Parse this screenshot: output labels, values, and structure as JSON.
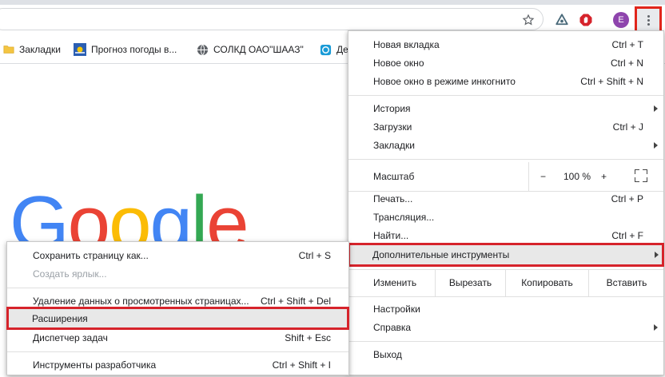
{
  "bookmarks": [
    {
      "label": "Закладки",
      "icon": "folder-icon"
    },
    {
      "label": "Прогноз погоды в...",
      "icon": "weather-icon"
    },
    {
      "label": "СОЛКД ОАО\"ШААЗ\"",
      "icon": "globe-icon"
    },
    {
      "label": "Де",
      "icon": "app-icon"
    }
  ],
  "toolbar": {
    "avatar_initial": "E"
  },
  "logo": {
    "letters": [
      "G",
      "o",
      "o",
      "g",
      "l",
      "e"
    ],
    "colors": [
      "#4285F4",
      "#EA4335",
      "#FBBC05",
      "#4285F4",
      "#34A853",
      "#EA4335"
    ]
  },
  "main_menu": {
    "new_tab": {
      "label": "Новая вкладка",
      "shortcut": "Ctrl + T"
    },
    "new_window": {
      "label": "Новое окно",
      "shortcut": "Ctrl + N"
    },
    "incognito": {
      "label": "Новое окно в режиме инкогнито",
      "shortcut": "Ctrl + Shift + N"
    },
    "history": {
      "label": "История"
    },
    "downloads": {
      "label": "Загрузки",
      "shortcut": "Ctrl + J"
    },
    "bookmarks": {
      "label": "Закладки"
    },
    "zoom": {
      "label": "Масштаб",
      "minus": "−",
      "value": "100 %",
      "plus": "+"
    },
    "print": {
      "label": "Печать...",
      "shortcut": "Ctrl + P"
    },
    "cast": {
      "label": "Трансляция..."
    },
    "find": {
      "label": "Найти...",
      "shortcut": "Ctrl + F"
    },
    "more_tools": {
      "label": "Дополнительные инструменты"
    },
    "edit": {
      "label": "Изменить",
      "cut": "Вырезать",
      "copy": "Копировать",
      "paste": "Вставить"
    },
    "settings": {
      "label": "Настройки"
    },
    "help": {
      "label": "Справка"
    },
    "exit": {
      "label": "Выход"
    }
  },
  "sub_menu": {
    "save_page": {
      "label": "Сохранить страницу как...",
      "shortcut": "Ctrl + S"
    },
    "create_shortcut": {
      "label": "Создать ярлык..."
    },
    "clear_data": {
      "label": "Удаление данных о просмотренных страницах...",
      "shortcut": "Ctrl + Shift + Del"
    },
    "extensions": {
      "label": "Расширения"
    },
    "task_manager": {
      "label": "Диспетчер задач",
      "shortcut": "Shift + Esc"
    },
    "dev_tools": {
      "label": "Инструменты разработчика",
      "shortcut": "Ctrl + Shift + I"
    }
  },
  "colors": {
    "highlight_border": "#d6232b",
    "hover_bg": "#e8e8e8"
  }
}
